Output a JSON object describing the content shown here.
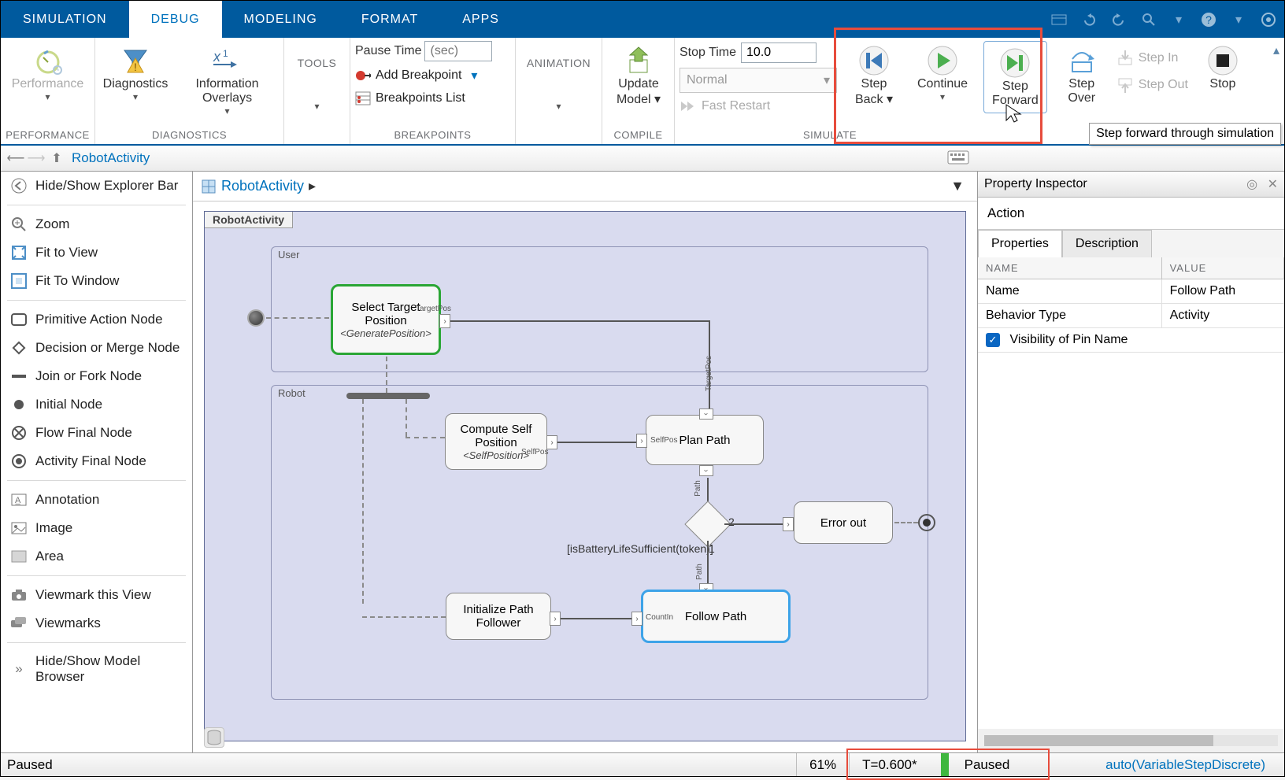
{
  "tabs": [
    "SIMULATION",
    "DEBUG",
    "MODELING",
    "FORMAT",
    "APPS"
  ],
  "active_tab": "DEBUG",
  "ribbon": {
    "performance": {
      "label": "Performance",
      "group": "PERFORMANCE"
    },
    "diagnostics": {
      "diag": "Diagnostics",
      "info": "Information Overlays",
      "group": "DIAGNOSTICS"
    },
    "tools": {
      "label": "TOOLS"
    },
    "breakpoints": {
      "pause_label": "Pause Time",
      "pause_placeholder": "(sec)",
      "add": "Add Breakpoint",
      "list": "Breakpoints List",
      "group": "BREAKPOINTS"
    },
    "animation": {
      "label": "ANIMATION"
    },
    "compile": {
      "update": "Update Model",
      "group": "COMPILE"
    },
    "simulate": {
      "stop_label": "Stop Time",
      "stop_value": "10.0",
      "mode": "Normal",
      "fast": "Fast Restart",
      "back": "Step Back",
      "cont": "Continue",
      "fwd": "Step Forward",
      "over": "Step Over",
      "in": "Step In",
      "out": "Step Out",
      "stop": "Stop",
      "group": "SIMULATE"
    },
    "tooltip": "Step forward through simulation"
  },
  "navbar": {
    "title": "RobotActivity"
  },
  "crumb": {
    "model": "RobotActivity"
  },
  "left": {
    "hide": "Hide/Show Explorer Bar",
    "zoom": "Zoom",
    "fitview": "Fit to View",
    "fitwin": "Fit To Window",
    "prim": "Primitive Action Node",
    "decision": "Decision or Merge Node",
    "fork": "Join or Fork Node",
    "initial": "Initial Node",
    "flowfinal": "Flow Final Node",
    "actfinal": "Activity Final Node",
    "annot": "Annotation",
    "image": "Image",
    "area": "Area",
    "viewmark": "Viewmark this View",
    "viewmarks": "Viewmarks",
    "browser": "Hide/Show Model Browser"
  },
  "diagram": {
    "title": "RobotActivity",
    "region_user": "User",
    "region_robot": "Robot",
    "select": "Select Target Position",
    "select_sub": "<GeneratePosition>",
    "select_pin": "TargetPos",
    "compute": "Compute Self Position",
    "compute_sub": "<SelfPosition>",
    "compute_pin": "SelfPos",
    "plan": "Plan Path",
    "plan_pin_in": "SelfPos",
    "plan_pin_top": "TargetPos",
    "plan_pin_out": "Path",
    "error": "Error out",
    "init": "Initialize Path Follower",
    "follow": "Follow Path",
    "follow_pin_in": "CountIn",
    "follow_pin_top": "Path",
    "guard1": "[isBatteryLifeSufficient(token)]",
    "g1n": "1",
    "g2n": "2"
  },
  "inspector": {
    "title": "Property Inspector",
    "section": "Action",
    "tab_props": "Properties",
    "tab_desc": "Description",
    "col_name": "NAME",
    "col_val": "VALUE",
    "rows": [
      {
        "n": "Name",
        "v": "Follow Path"
      },
      {
        "n": "Behavior Type",
        "v": "Activity"
      }
    ],
    "vis": "Visibility of Pin Name"
  },
  "status": {
    "state": "Paused",
    "pct": "61%",
    "time": "T=0.600*",
    "sim": "Paused",
    "solver": "auto(VariableStepDiscrete)"
  }
}
